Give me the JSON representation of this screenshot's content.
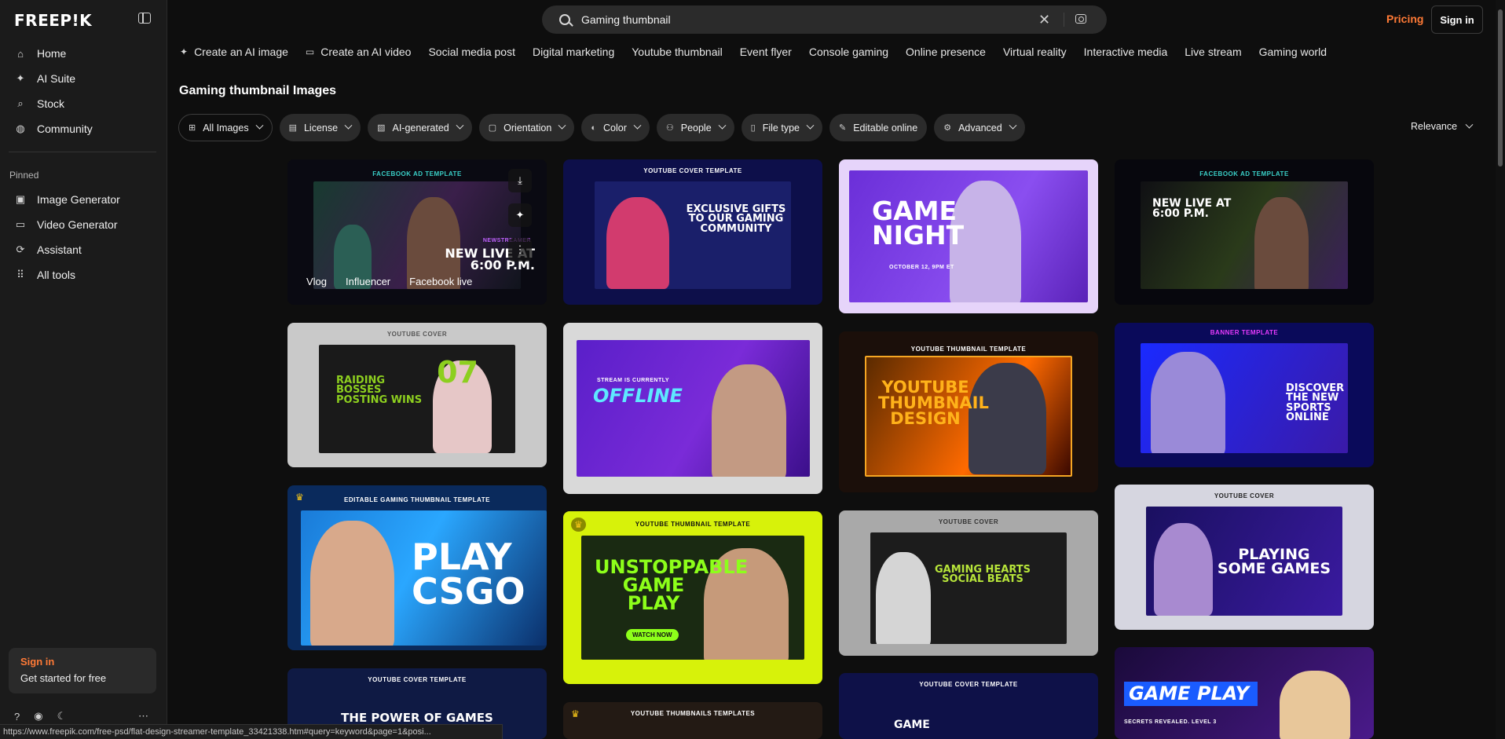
{
  "brand": {
    "logo": "FREEP!K",
    "accent": "#ff7a36"
  },
  "sidebar": {
    "main": [
      {
        "icon": "home-icon",
        "glyph": "⌂",
        "label": "Home"
      },
      {
        "icon": "ai-suite-icon",
        "glyph": "✦",
        "label": "AI Suite"
      },
      {
        "icon": "search-icon",
        "glyph": "⌕",
        "label": "Stock"
      },
      {
        "icon": "globe-icon",
        "glyph": "◍",
        "label": "Community"
      }
    ],
    "pinned_label": "Pinned",
    "pinned": [
      {
        "icon": "image-icon",
        "glyph": "▣",
        "label": "Image Generator"
      },
      {
        "icon": "video-icon",
        "glyph": "▭",
        "label": "Video Generator"
      },
      {
        "icon": "assistant-icon",
        "glyph": "⟳",
        "label": "Assistant"
      },
      {
        "icon": "grid-icon",
        "glyph": "⠿",
        "label": "All tools"
      }
    ],
    "signin_card": {
      "title": "Sign in",
      "subtitle": "Get started for free"
    }
  },
  "header": {
    "search_query": "Gaming thumbnail",
    "pricing": "Pricing",
    "signin": "Sign in"
  },
  "tags": [
    {
      "icon": "sparkle-icon",
      "glyph": "✦",
      "label": "Create an AI image"
    },
    {
      "icon": "video-icon",
      "glyph": "▭",
      "label": "Create an AI video"
    },
    {
      "label": "Social media post"
    },
    {
      "label": "Digital marketing"
    },
    {
      "label": "Youtube thumbnail"
    },
    {
      "label": "Event flyer"
    },
    {
      "label": "Console gaming"
    },
    {
      "label": "Online presence"
    },
    {
      "label": "Virtual reality"
    },
    {
      "label": "Interactive media"
    },
    {
      "label": "Live stream"
    },
    {
      "label": "Gaming world"
    }
  ],
  "page_title": "Gaming thumbnail Images",
  "filters": [
    {
      "label": "All Images",
      "icon": "grid-icon",
      "glyph": "⊞",
      "outline": true,
      "dropdown": true
    },
    {
      "label": "License",
      "icon": "license-icon",
      "glyph": "▤",
      "dropdown": true
    },
    {
      "label": "AI-generated",
      "icon": "ai-icon",
      "glyph": "▧",
      "dropdown": true
    },
    {
      "label": "Orientation",
      "icon": "orientation-icon",
      "glyph": "▢",
      "dropdown": true
    },
    {
      "label": "Color",
      "icon": "palette-icon",
      "glyph": "◐",
      "dropdown": true
    },
    {
      "label": "People",
      "icon": "people-icon",
      "glyph": "⚇",
      "dropdown": true
    },
    {
      "label": "File type",
      "icon": "file-icon",
      "glyph": "▯",
      "dropdown": true
    },
    {
      "label": "Editable online",
      "icon": "edit-icon",
      "glyph": "✎",
      "dropdown": false
    },
    {
      "label": "Advanced",
      "icon": "gear-icon",
      "glyph": "⚙",
      "dropdown": true
    }
  ],
  "sort": "Relevance",
  "hover_tags": [
    "Vlog",
    "Influencer",
    "Facebook live"
  ],
  "cards": {
    "c1": {
      "cap": "FACEBOOK AD TEMPLATE",
      "text": "NEW LIVE AT 6:00 P.M.",
      "sub": "NEWSTREAMER"
    },
    "c2": {
      "cap": "YOUTUBE COVER TEMPLATE",
      "text": "EXCLUSIVE GIFTS TO OUR GAMING COMMUNITY"
    },
    "c3": {
      "text": "GAME NIGHT",
      "sub": "OCTOBER 12, 9PM ET"
    },
    "c4": {
      "cap": "FACEBOOK AD TEMPLATE",
      "text": "NEW LIVE AT 6:00 P.M."
    },
    "c5": {
      "cap": "YOUTUBE COVER",
      "text": "RAIDING BOSSES POSTING WINS"
    },
    "c6": {
      "text": "OFFLINE",
      "sub": "STREAM IS CURRENTLY"
    },
    "c7": {
      "cap": "YOUTUBE THUMBNAIL TEMPLATE",
      "text": "YOUTUBE THUMBNAIL DESIGN"
    },
    "c8": {
      "cap": "BANNER TEMPLATE",
      "text": "DISCOVER THE NEW SPORTS ONLINE"
    },
    "c9": {
      "cap": "EDITABLE GAMING THUMBNAIL TEMPLATE",
      "text": "PLAY CSGO"
    },
    "c10": {
      "cap": "YOUTUBE THUMBNAIL TEMPLATE",
      "text": "UNSTOPPABLE GAME PLAY",
      "sub": "WATCH NOW"
    },
    "c11": {
      "cap": "YOUTUBE COVER",
      "text": "GAMING HEARTS SOCIAL BEATS"
    },
    "c12": {
      "cap": "YOUTUBE COVER",
      "text": "PLAYING SOME GAMES"
    },
    "c13": {
      "cap": "YOUTUBE COVER TEMPLATE",
      "text": "THE POWER OF GAMES"
    },
    "c14": {
      "cap": "YOUTUBE THUMBNAILS TEMPLATES"
    },
    "c15": {
      "cap": "YOUTUBE COVER TEMPLATE",
      "text": "GAME"
    },
    "c16": {
      "text": "GAME PLAY",
      "sub": "SECRETS REVEALED. LEVEL 3"
    }
  },
  "status_url": "https://www.freepik.com/free-psd/flat-design-streamer-template_33421338.htm#query=keyword&page=1&posi..."
}
